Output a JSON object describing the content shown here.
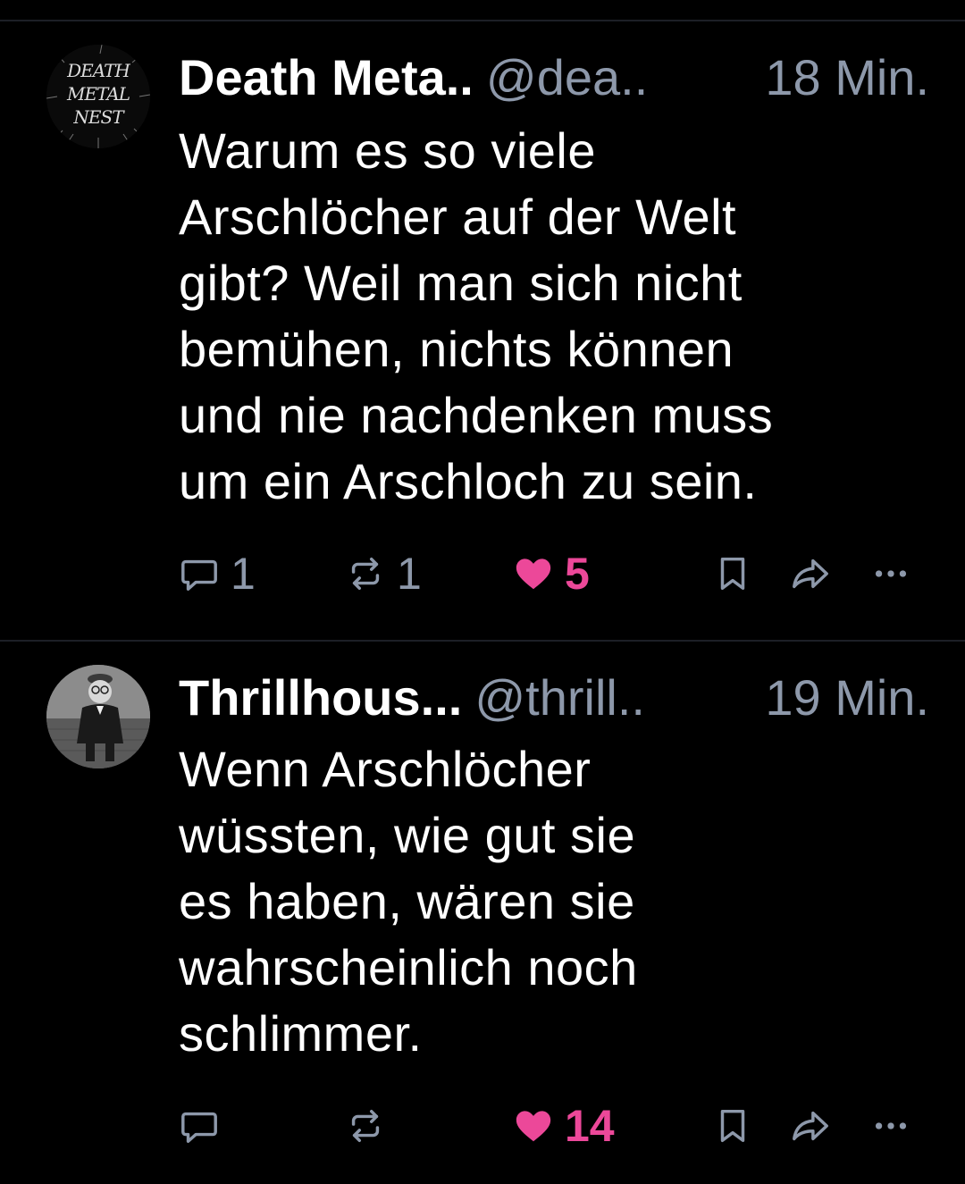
{
  "posts": [
    {
      "author": "Death Meta..",
      "handle": "@dea..",
      "time": "18 Min.",
      "avatar_logo_text": "DEATH METAL NEST",
      "text": [
        "Warum es so viele",
        "Arschlöcher auf der Welt",
        "gibt? Weil man sich nicht",
        "bemühen, nichts können",
        "und nie nachdenken muss",
        "um ein Arschloch zu sein."
      ],
      "reply_count": "1",
      "repost_count": "1",
      "like_count": "5",
      "liked": true
    },
    {
      "author": "Thrillhous...",
      "handle": "@thrill..",
      "time": "19 Min.",
      "text": [
        "Wenn Arschlöcher",
        "wüssten, wie gut sie",
        "es haben, wären sie",
        "wahrscheinlich noch",
        "schlimmer."
      ],
      "reply_count": "",
      "repost_count": "",
      "like_count": "14",
      "liked": true
    }
  ],
  "icons": {
    "reply": "speech-bubble-icon",
    "repost": "repost-arrows-icon",
    "like": "heart-icon",
    "bookmark": "bookmark-icon",
    "share": "share-arrow-icon",
    "more": "ellipsis-icon"
  },
  "colors": {
    "background": "#000000",
    "text": "#ffffff",
    "muted": "#8d98aa",
    "like": "#ec4899",
    "divider": "#1c1f26"
  }
}
